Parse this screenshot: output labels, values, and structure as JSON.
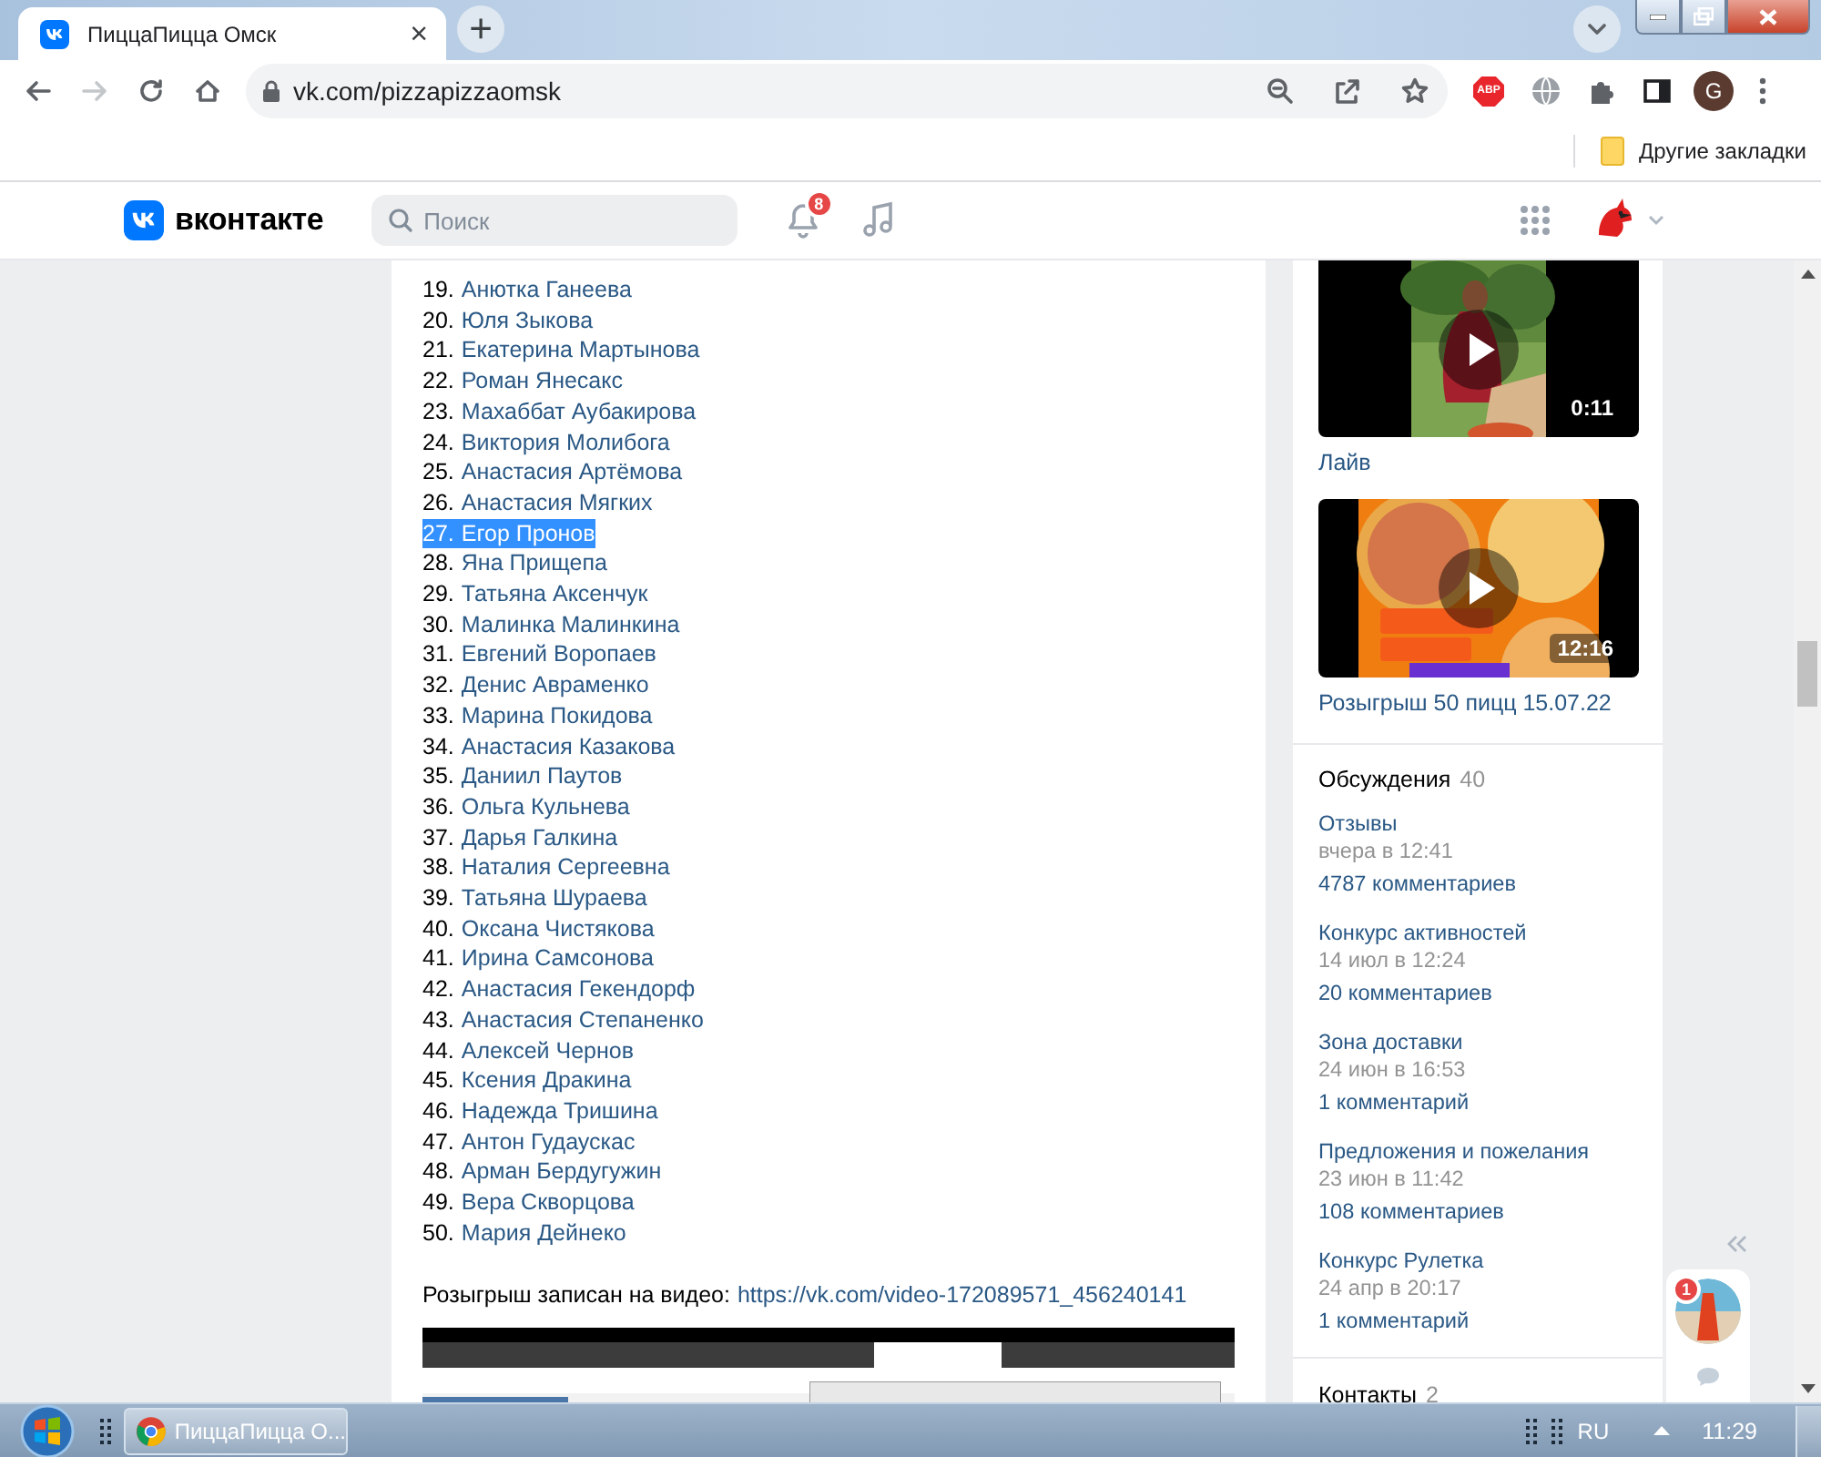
{
  "browser": {
    "tab": {
      "title": "ПиццаПицца Омск",
      "close": "×"
    },
    "new_tab": "+",
    "nav": [
      {
        "kind": "back",
        "disabled": false
      },
      {
        "kind": "forward",
        "disabled": true
      },
      {
        "kind": "reload",
        "disabled": false
      },
      {
        "kind": "home",
        "disabled": false
      }
    ],
    "url": "vk.com/pizzapizzaomsk",
    "abp_label": "ABP",
    "profile_initial": "G",
    "bookmarks": [
      {
        "label": "Другие закладки"
      }
    ]
  },
  "header": {
    "logo_text": "вконтакте",
    "search": {
      "placeholder": "Поиск"
    },
    "notifications_badge": "8"
  },
  "post": {
    "winners": [
      {
        "number": "19.",
        "name": "Анютка Ганеева",
        "selected": false
      },
      {
        "number": "20.",
        "name": "Юля Зыкова",
        "selected": false
      },
      {
        "number": "21.",
        "name": "Екатерина Мартынова",
        "selected": false
      },
      {
        "number": "22.",
        "name": "Роман Янесакс",
        "selected": false
      },
      {
        "number": "23.",
        "name": "Махаббат Аубакирова",
        "selected": false
      },
      {
        "number": "24.",
        "name": "Виктория Молибога",
        "selected": false
      },
      {
        "number": "25.",
        "name": "Анастасия Артёмова",
        "selected": false
      },
      {
        "number": "26.",
        "name": "Анастасия Мягких",
        "selected": false
      },
      {
        "number": "27.",
        "name": "Егор Пронов",
        "selected": true
      },
      {
        "number": "28.",
        "name": "Яна Прищепа",
        "selected": false
      },
      {
        "number": "29.",
        "name": "Татьяна Аксенчук",
        "selected": false
      },
      {
        "number": "30.",
        "name": "Малинка Малинкина",
        "selected": false
      },
      {
        "number": "31.",
        "name": "Евгений Воропаев",
        "selected": false
      },
      {
        "number": "32.",
        "name": "Денис Авраменко",
        "selected": false
      },
      {
        "number": "33.",
        "name": "Марина Покидова",
        "selected": false
      },
      {
        "number": "34.",
        "name": "Анастасия Казакова",
        "selected": false
      },
      {
        "number": "35.",
        "name": "Даниил Паутов",
        "selected": false
      },
      {
        "number": "36.",
        "name": "Ольга Кульнева",
        "selected": false
      },
      {
        "number": "37.",
        "name": "Дарья Галкина",
        "selected": false
      },
      {
        "number": "38.",
        "name": "Наталия Сергеевна",
        "selected": false
      },
      {
        "number": "39.",
        "name": "Татьяна Шураева",
        "selected": false
      },
      {
        "number": "40.",
        "name": "Оксана Чистякова",
        "selected": false
      },
      {
        "number": "41.",
        "name": "Ирина Самсонова",
        "selected": false
      },
      {
        "number": "42.",
        "name": "Анастасия Гекендорф",
        "selected": false
      },
      {
        "number": "43.",
        "name": "Анастасия Степаненко",
        "selected": false
      },
      {
        "number": "44.",
        "name": "Алексей Чернов",
        "selected": false
      },
      {
        "number": "45.",
        "name": "Ксения Дракина",
        "selected": false
      },
      {
        "number": "46.",
        "name": "Надежда Тришина",
        "selected": false
      },
      {
        "number": "47.",
        "name": "Антон Гудаускас",
        "selected": false
      },
      {
        "number": "48.",
        "name": "Арман Бердугужин",
        "selected": false
      },
      {
        "number": "49.",
        "name": "Вера Скворцова",
        "selected": false
      },
      {
        "number": "50.",
        "name": "Мария Дейнеко",
        "selected": false
      }
    ],
    "video_note": {
      "text": "Розыгрыш записан на видео:",
      "link": "https://vk.com/video-172089571_456240141"
    }
  },
  "sidebar": {
    "videos": [
      {
        "duration": "0:11",
        "title": "Лайв"
      },
      {
        "duration": "12:16",
        "title": "Розыгрыш 50 пицц 15.07.22"
      }
    ],
    "discussions": {
      "title": "Обсуждения",
      "count": "40",
      "topics": [
        {
          "title": "Отзывы",
          "date": "вчера в 12:41",
          "comments": "4787 комментариев"
        },
        {
          "title": "Конкурс активностей",
          "date": "14 июл в 12:24",
          "comments": "20 комментариев"
        },
        {
          "title": "Зона доставки",
          "date": "24 июн в 16:53",
          "comments": "1 комментарий"
        },
        {
          "title": "Предложения и пожелания",
          "date": "23 июн в 11:42",
          "comments": "108 комментариев"
        },
        {
          "title": "Конкурс Рулетка",
          "date": "24 апр в 20:17",
          "comments": "1 комментарий"
        }
      ]
    },
    "contacts": {
      "title": "Контакты",
      "count": "2"
    }
  },
  "chat_widget": {
    "badge": "1"
  },
  "taskbar": {
    "app": {
      "label": "ПиццаПицца О..."
    },
    "language": "RU",
    "time": "11:29"
  }
}
